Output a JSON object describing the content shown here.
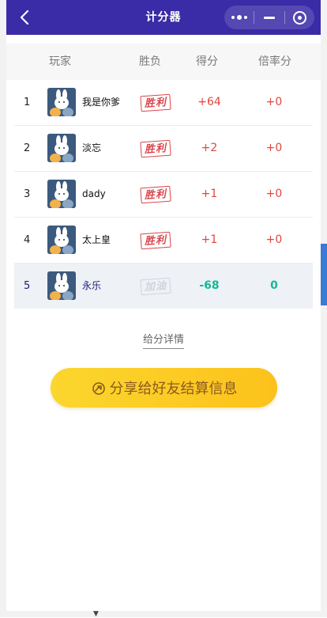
{
  "titlebar": {
    "title": "计分器"
  },
  "table": {
    "headers": {
      "player": "玩家",
      "result": "胜负",
      "score": "得分",
      "ratio": "倍率分"
    },
    "rows": [
      {
        "rank": "1",
        "name": "我是你爹",
        "result": "胜利",
        "score": "+64",
        "ratio": "+0",
        "status": "win"
      },
      {
        "rank": "2",
        "name": "淡忘",
        "result": "胜利",
        "score": "+2",
        "ratio": "+0",
        "status": "win"
      },
      {
        "rank": "3",
        "name": "dady",
        "result": "胜利",
        "score": "+1",
        "ratio": "+0",
        "status": "win"
      },
      {
        "rank": "4",
        "name": "太上皇",
        "result": "胜利",
        "score": "+1",
        "ratio": "+0",
        "status": "win"
      },
      {
        "rank": "5",
        "name": "永乐",
        "result": "加油",
        "score": "-68",
        "ratio": "0",
        "status": "lose"
      }
    ]
  },
  "links": {
    "detail": "给分详情"
  },
  "share": {
    "label": "分享给好友结算信息",
    "icon": "share-icon"
  },
  "icons": {
    "back": "back-icon",
    "more": "more-dots-icon",
    "minimize": "minimize-icon",
    "close": "close-target-icon"
  },
  "colors": {
    "titlebar": "#3a2ba6",
    "win": "#e0463e",
    "lose": "#16b895",
    "share": "#fcc21b"
  }
}
